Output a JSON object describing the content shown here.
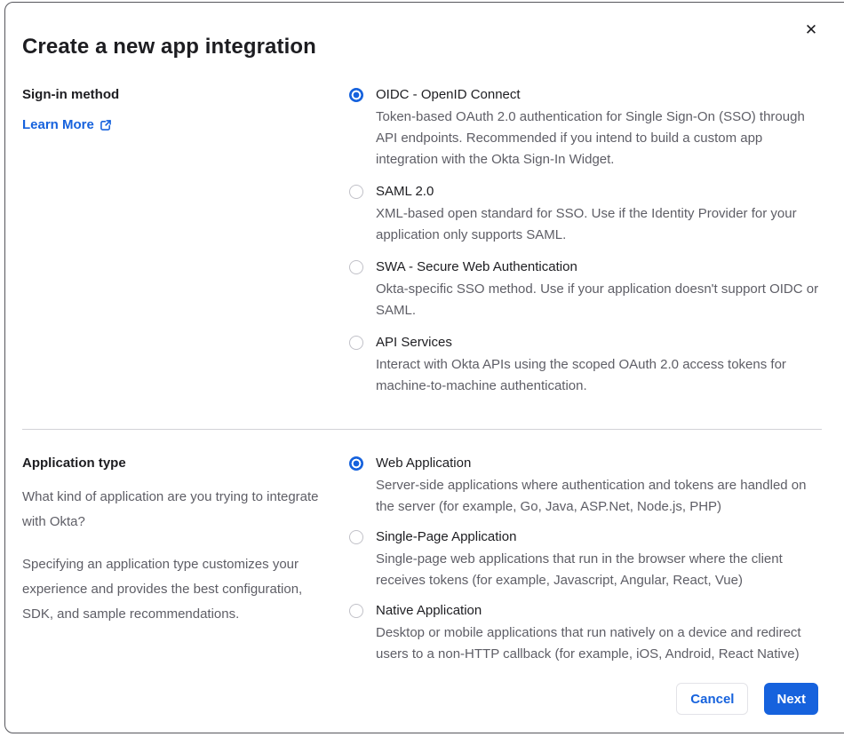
{
  "modal": {
    "title": "Create a new app integration",
    "close_icon": "✕"
  },
  "colors": {
    "accent_blue": "#1662dd",
    "text_dark": "#1d1d21",
    "text_gray": "#5e5e66",
    "divider": "#d2d2d7",
    "radio_border": "#c1c1c8"
  },
  "sign_in_section": {
    "label": "Sign-in method",
    "learn_more_label": "Learn More",
    "options": [
      {
        "label": "OIDC - OpenID Connect",
        "description": "Token-based OAuth 2.0 authentication for Single Sign-On (SSO) through API endpoints. Recommended if you intend to build a custom app integration with the Okta Sign-In Widget.",
        "selected": true
      },
      {
        "label": "SAML 2.0",
        "description": "XML-based open standard for SSO. Use if the Identity Provider for your application only supports SAML.",
        "selected": false
      },
      {
        "label": "SWA - Secure Web Authentication",
        "description": "Okta-specific SSO method. Use if your application doesn't support OIDC or SAML.",
        "selected": false
      },
      {
        "label": "API Services",
        "description": "Interact with Okta APIs using the scoped OAuth 2.0 access tokens for machine-to-machine authentication.",
        "selected": false
      }
    ]
  },
  "application_type_section": {
    "label": "Application type",
    "paragraph1": "What kind of application are you trying to integrate with Okta?",
    "paragraph2": "Specifying an application type customizes your experience and provides the best configuration, SDK, and sample recommendations.",
    "options": [
      {
        "label": "Web Application",
        "description": "Server-side applications where authentication and tokens are handled on the server (for example, Go, Java, ASP.Net, Node.js, PHP)",
        "selected": true
      },
      {
        "label": "Single-Page Application",
        "description": "Single-page web applications that run in the browser where the client receives tokens (for example, Javascript, Angular, React, Vue)",
        "selected": false
      },
      {
        "label": "Native Application",
        "description": "Desktop or mobile applications that run natively on a device and redirect users to a non-HTTP callback (for example, iOS, Android, React Native)",
        "selected": false
      }
    ]
  },
  "footer": {
    "cancel_label": "Cancel",
    "next_label": "Next"
  }
}
